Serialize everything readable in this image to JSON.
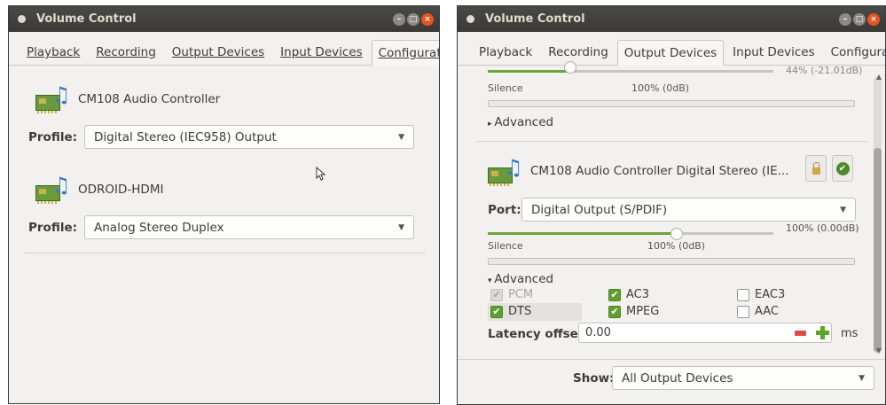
{
  "left": {
    "title": "Volume Control",
    "tabs": [
      {
        "label": "Playback"
      },
      {
        "label": "Recording"
      },
      {
        "label": "Output Devices"
      },
      {
        "label": "Input Devices"
      },
      {
        "label": "Configuration"
      }
    ],
    "devices": [
      {
        "name": "CM108 Audio Controller",
        "profile_label": "Profile:",
        "profile": "Digital Stereo (IEC958) Output"
      },
      {
        "name": "ODROID-HDMI",
        "profile_label": "Profile:",
        "profile": "Analog Stereo Duplex"
      }
    ]
  },
  "right": {
    "title": "Volume Control",
    "tabs": [
      {
        "label": "Playback"
      },
      {
        "label": "Recording"
      },
      {
        "label": "Output Devices"
      },
      {
        "label": "Input Devices"
      },
      {
        "label": "Configuration"
      }
    ],
    "top_device": {
      "volume_readout_partial": "44% (-21.01dB)",
      "silence": "Silence",
      "mark_100": "100% (0dB)",
      "advanced": "Advanced"
    },
    "device": {
      "name": "CM108 Audio Controller Digital Stereo (IE...",
      "port_label": "Port:",
      "port": "Digital Output (S/PDIF)",
      "volume_readout": "100% (0.00dB)",
      "volume_fraction": 1.0,
      "silence": "Silence",
      "mark_100": "100% (0dB)",
      "advanced": "Advanced",
      "formats": [
        {
          "label": "PCM",
          "checked": true,
          "disabled": true
        },
        {
          "label": "AC3",
          "checked": true,
          "disabled": false
        },
        {
          "label": "EAC3",
          "checked": false,
          "disabled": false
        },
        {
          "label": "DTS",
          "checked": true,
          "disabled": false
        },
        {
          "label": "MPEG",
          "checked": true,
          "disabled": false
        },
        {
          "label": "AAC",
          "checked": false,
          "disabled": false
        }
      ],
      "latency_label": "Latency offset:",
      "latency_value": "0.00",
      "latency_unit": "ms"
    },
    "show_label": "Show:",
    "show_value": "All Output Devices"
  }
}
